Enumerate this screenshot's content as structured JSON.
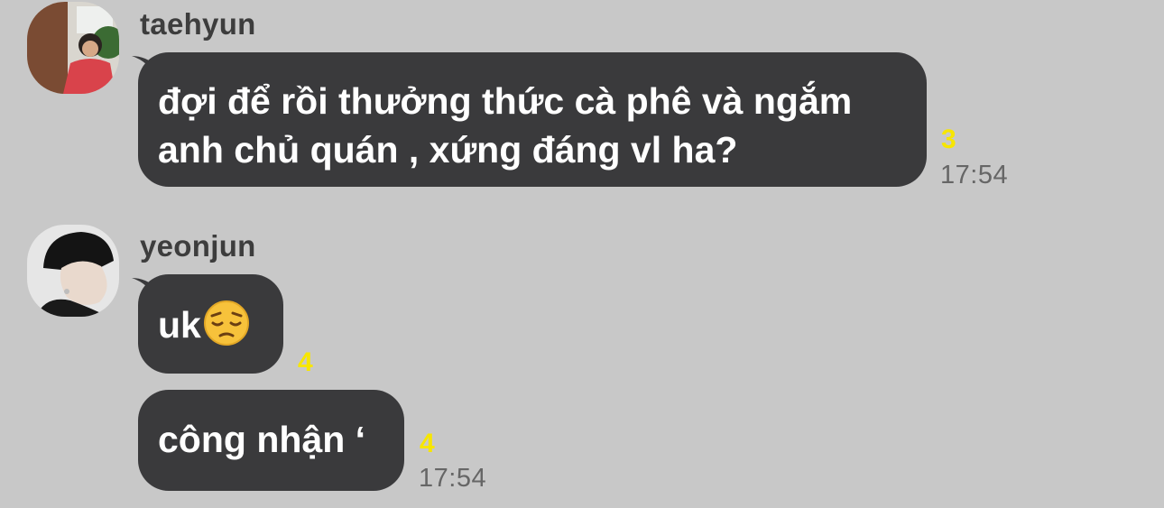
{
  "messages": [
    {
      "sender": "taehyun",
      "text_line1": "đợi để rồi thưởng thức cà phê và ngắm",
      "text_line2": "anh chủ quán , xứng đáng vl ha?",
      "unread": "3",
      "time": "17:54"
    },
    {
      "sender": "yeonjun",
      "text": "uk",
      "emoji": "pensive-face-emoji",
      "unread": "4"
    },
    {
      "text": "công nhận ‘",
      "unread": "4",
      "time": "17:54"
    }
  ],
  "colors": {
    "background": "#c8c8c8",
    "bubble": "#3a3a3c",
    "unread": "#f7e600",
    "time": "#666666"
  }
}
